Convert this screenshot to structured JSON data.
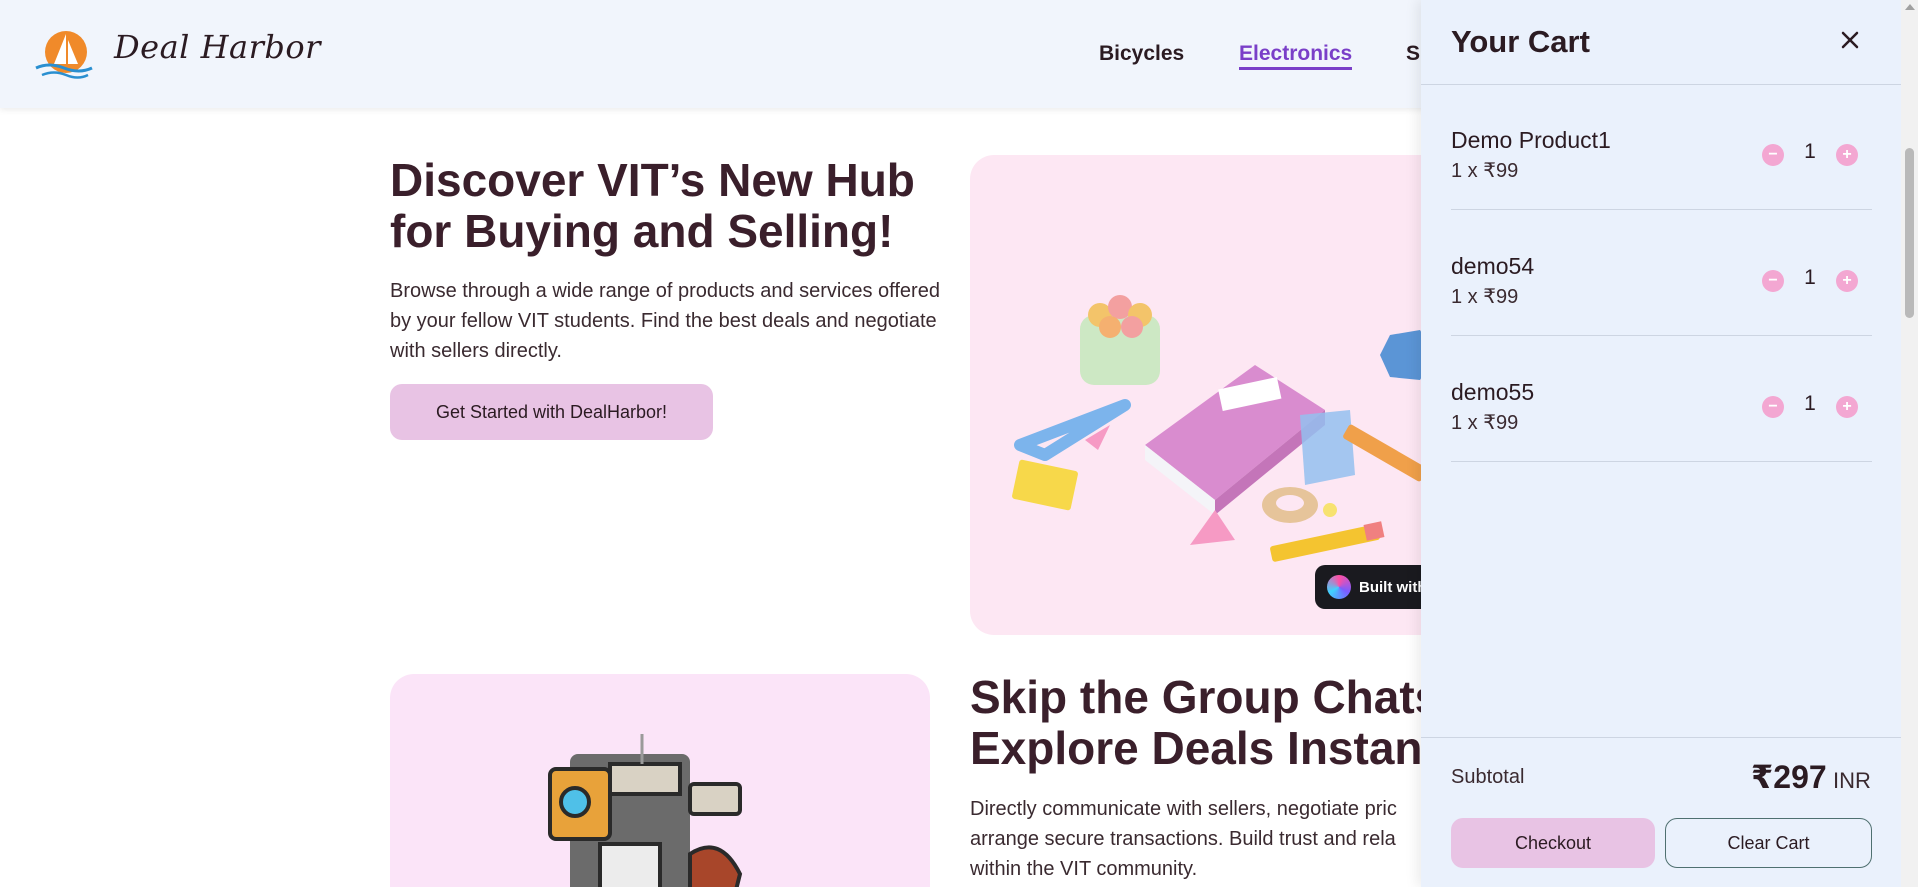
{
  "header": {
    "brand": "Deal Harbor",
    "nav": [
      {
        "label": "Bicycles"
      },
      {
        "label": "Electronics"
      },
      {
        "label": "S"
      }
    ]
  },
  "hero": {
    "title": "Discover VIT’s New Hub for Buying and Selling!",
    "description": "Browse through a wide range of products and services offered by your fellow VIT students. Find the best deals and negotiate with sellers directly.",
    "cta": "Get Started with DealHarbor!",
    "badge": "Built with"
  },
  "section2": {
    "title_line1": "Skip the Group Chats",
    "title_line2": "Explore Deals Instant",
    "desc_line1": "Directly communicate with sellers, negotiate pric",
    "desc_line2": "arrange secure transactions. Build trust and rela",
    "desc_line3": "within the VIT community."
  },
  "cart": {
    "title": "Your Cart",
    "items": [
      {
        "name": "Demo Product1",
        "price": "1 x ₹99",
        "qty": "1"
      },
      {
        "name": "demo54",
        "price": "1 x ₹99",
        "qty": "1"
      },
      {
        "name": "demo55",
        "price": "1 x ₹99",
        "qty": "1"
      }
    ],
    "subtotal_label": "Subtotal",
    "subtotal_amount": "₹297",
    "currency": "INR",
    "checkout": "Checkout",
    "clear": "Clear Cart"
  },
  "colors": {
    "accent": "#7a3fc8",
    "button_pink": "#e8c3e4",
    "qty_pink": "#f3a7d2",
    "drawer_bg": "#eaf1fc"
  },
  "icons": {
    "logo": "sailboat-sun-logo",
    "close": "close-icon",
    "minus": "minus-icon",
    "plus": "plus-icon"
  }
}
